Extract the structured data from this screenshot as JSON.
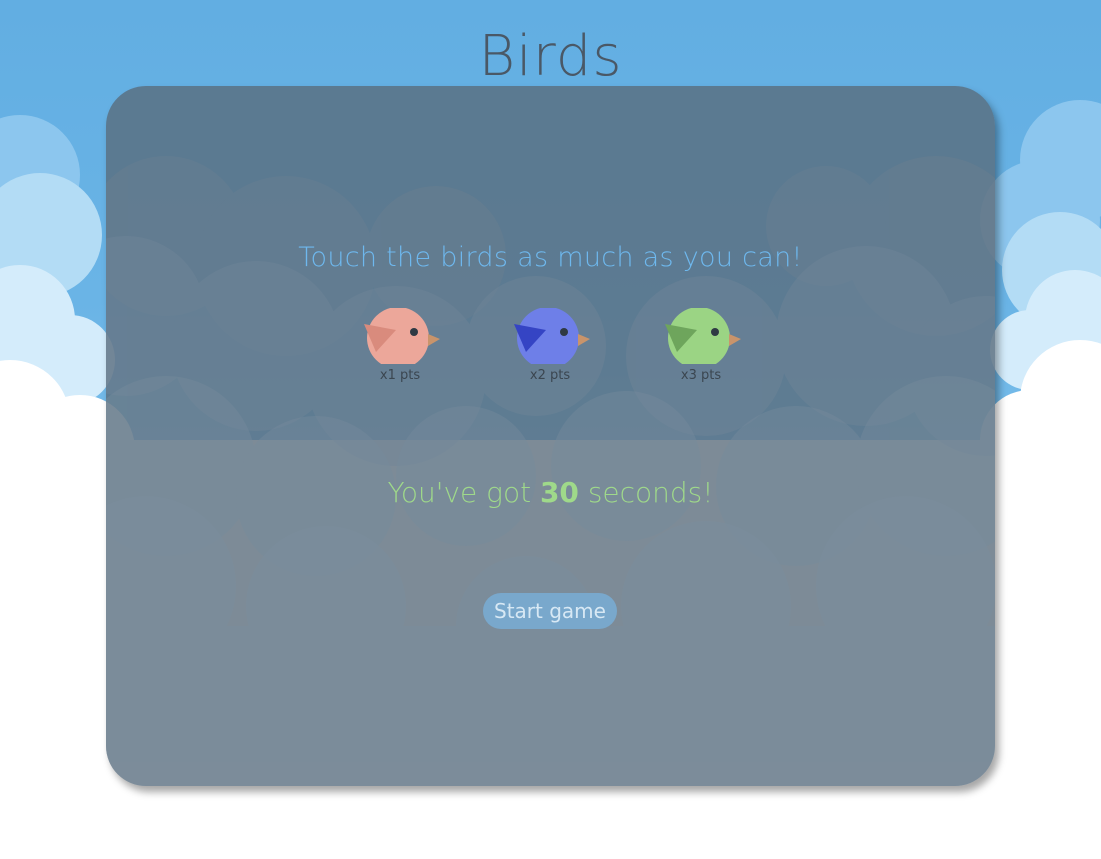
{
  "page": {
    "title": "Birds"
  },
  "game": {
    "instructions": "Touch the birds as much as you can!",
    "birds": [
      {
        "color": "#eca79a",
        "wing_color": "#d98b7d",
        "points_label": "x1 pts"
      },
      {
        "color": "#6e7fe8",
        "wing_color": "#3544c4",
        "points_label": "x2 pts"
      },
      {
        "color": "#9bd484",
        "wing_color": "#6ea55c",
        "points_label": "x3 pts"
      }
    ],
    "timer": {
      "prefix": "You've got ",
      "seconds": "30",
      "suffix": " seconds!"
    },
    "start_button_label": "Start game"
  },
  "colors": {
    "sky": "#62aee2",
    "panel_overlay": "#586a7a",
    "instructions_text": "#6eb8ee",
    "timer_text": "#9fd98a",
    "button_bg": "#79a8cc",
    "beak": "#c9946b"
  }
}
